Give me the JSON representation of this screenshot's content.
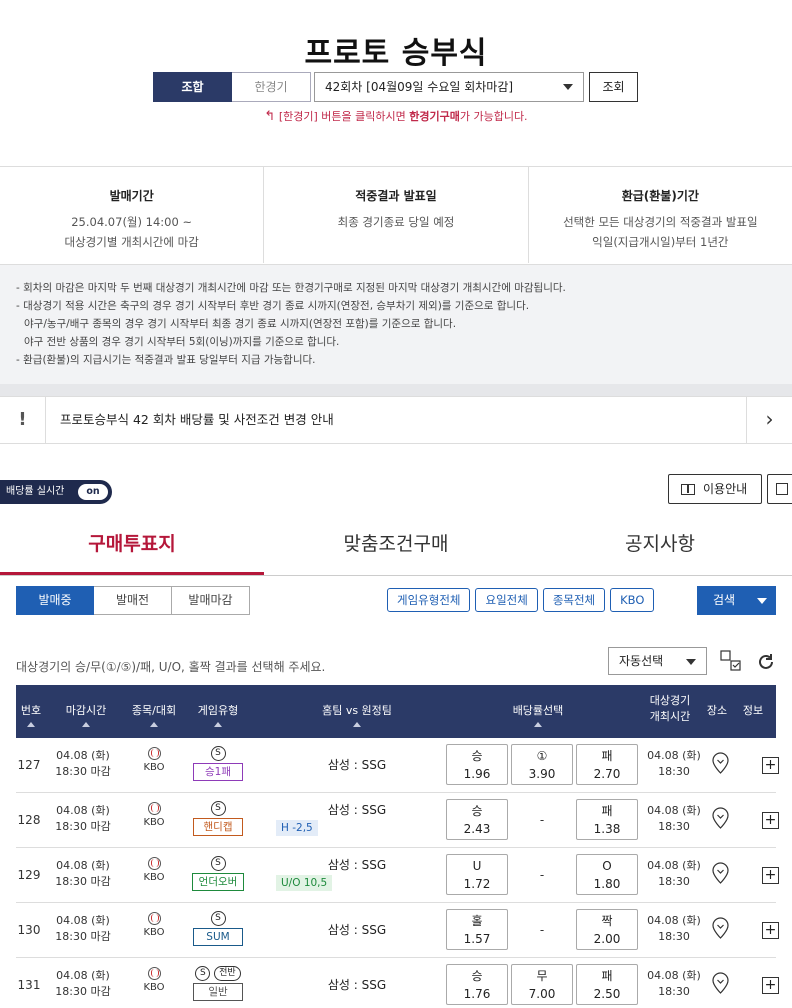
{
  "page_title": "프로토 승부식",
  "mode_tabs": [
    "조합",
    "한경기"
  ],
  "round_select": "42회차 [04월09일 수요일 회차마감]",
  "search_label": "조회",
  "hint": {
    "prefix": "[한경기] 버튼을 클릭하시면 ",
    "bold": "한경기구매",
    "suffix": "가 가능합니다."
  },
  "info": [
    {
      "heading": "발매기간",
      "lines": [
        "25.04.07(월) 14:00 ~",
        "대상경기별 개최시간에 마감"
      ]
    },
    {
      "heading": "적중결과 발표일",
      "lines": [
        "최종 경기종료 당일 예정"
      ]
    },
    {
      "heading": "환급(환불)기간",
      "lines": [
        "선택한 모든 대상경기의 적중결과 발표일",
        "익일(지급개시일)부터 1년간"
      ]
    }
  ],
  "notes": [
    "- 회차의 마감은 마지막 두 번째 대상경기 개최시간에 마감 또는 한경기구매로 지정된 마지막 대상경기 개최시간에 마감됩니다.",
    "- 대상경기 적용 시간은 축구의 경우 경기 시작부터 후반 경기 종료 시까지(연장전, 승부차기 제외)를 기준으로 합니다.",
    "  야구/농구/배구 종목의 경우 경기 시작부터 최종 경기 종료 시까지(연장전 포함)를 기준으로 합니다.",
    "  야구 전반 상품의 경우 경기 시작부터 5회(이닝)까지를 기준으로 합니다.",
    "- 환급(환불)의 지급시기는 적중결과 발표 당일부터 지급 가능합니다."
  ],
  "notice": {
    "mark": "!",
    "text": "프로토승부식 42 회차 배당률 및 사전조건 변경 안내",
    "arrow": "›"
  },
  "realtime": {
    "label": "배당률 실시간",
    "state": "on"
  },
  "guide_label": "이용안내",
  "main_tabs": [
    "구매투표지",
    "맞춤조건구매",
    "공지사항"
  ],
  "status_tabs": [
    "발매중",
    "발매전",
    "발매마감"
  ],
  "filters": [
    "게임유형전체",
    "요일전체",
    "종목전체",
    "KBO"
  ],
  "search_btn": "검색",
  "select_desc": "대상경기의 승/무(①/⑤)/패, U/O, 홀짝 결과를 선택해 주세요.",
  "auto_select": "자동선택",
  "columns": {
    "no": "번호",
    "deadline": "마감시간",
    "sport": "종목/대회",
    "gametype": "게임유형",
    "teams": "홈팀 vs 원정팀",
    "odds": "배당률선택",
    "start1": "대상경기",
    "start2": "개최시간",
    "venue": "장소",
    "info": "정보"
  },
  "colors": {
    "navy": "#2b3a67",
    "blue": "#1f5fb3",
    "red": "#b5173a"
  },
  "rows": [
    {
      "no": "127",
      "d1": "04.08 (화)",
      "d2": "18:30 마감",
      "league": "KBO",
      "s": "S",
      "jeonban": "",
      "type": "승1패",
      "type_color": "#8e3bb8",
      "teams": "삼성 : SSG",
      "handicap": "",
      "o1l": "승",
      "o1v": "1.96",
      "o2l": "①",
      "o2v": "3.90",
      "o3l": "패",
      "o3v": "2.70",
      "g1": "04.08 (화)",
      "g2": "18:30"
    },
    {
      "no": "128",
      "d1": "04.08 (화)",
      "d2": "18:30 마감",
      "league": "KBO",
      "s": "S",
      "jeonban": "",
      "type": "핸디캡",
      "type_color": "#c25a1e",
      "teams": "삼성 : SSG",
      "handicap": "H -2,5",
      "hcolor": "#1f5fb3",
      "hbg": "#e3ecf8",
      "o1l": "승",
      "o1v": "2.43",
      "o2l": "",
      "o2v": "-",
      "o3l": "패",
      "o3v": "1.38",
      "g1": "04.08 (화)",
      "g2": "18:30"
    },
    {
      "no": "129",
      "d1": "04.08 (화)",
      "d2": "18:30 마감",
      "league": "KBO",
      "s": "S",
      "jeonban": "",
      "type": "언더오버",
      "type_color": "#1e8a3c",
      "teams": "삼성 : SSG",
      "handicap": "U/O 10,5",
      "hcolor": "#1e8a3c",
      "hbg": "#e2f3e5",
      "o1l": "U",
      "o1v": "1.72",
      "o2l": "",
      "o2v": "-",
      "o3l": "O",
      "o3v": "1.80",
      "g1": "04.08 (화)",
      "g2": "18:30"
    },
    {
      "no": "130",
      "d1": "04.08 (화)",
      "d2": "18:30 마감",
      "league": "KBO",
      "s": "S",
      "jeonban": "",
      "type": "SUM",
      "type_color": "#1a5a8a",
      "teams": "삼성 : SSG",
      "handicap": "",
      "o1l": "홀",
      "o1v": "1.57",
      "o2l": "",
      "o2v": "-",
      "o3l": "짝",
      "o3v": "2.00",
      "g1": "04.08 (화)",
      "g2": "18:30"
    },
    {
      "no": "131",
      "d1": "04.08 (화)",
      "d2": "18:30 마감",
      "league": "KBO",
      "s": "S",
      "jeonban": "전반",
      "type": "일반",
      "type_color": "#555555",
      "teams": "삼성 : SSG",
      "handicap": "",
      "o1l": "승",
      "o1v": "1.76",
      "o2l": "무",
      "o2v": "7.00",
      "o3l": "패",
      "o3v": "2.50",
      "g1": "04.08 (화)",
      "g2": "18:30"
    }
  ]
}
